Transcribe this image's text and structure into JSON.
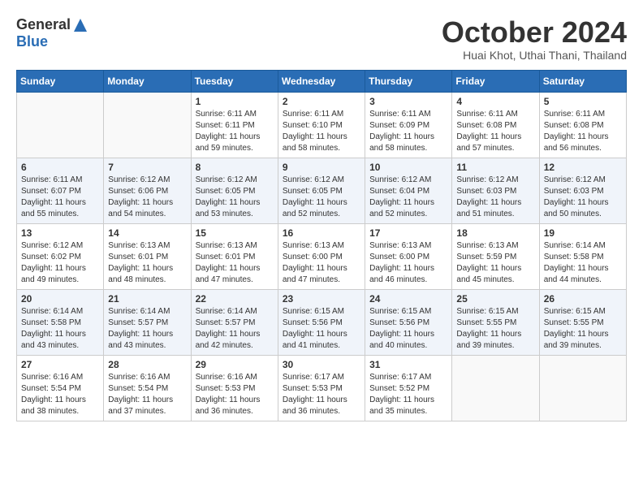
{
  "logo": {
    "general": "General",
    "blue": "Blue"
  },
  "header": {
    "month": "October 2024",
    "location": "Huai Khot, Uthai Thani, Thailand"
  },
  "columns": [
    "Sunday",
    "Monday",
    "Tuesday",
    "Wednesday",
    "Thursday",
    "Friday",
    "Saturday"
  ],
  "weeks": [
    [
      {
        "day": "",
        "info": ""
      },
      {
        "day": "",
        "info": ""
      },
      {
        "day": "1",
        "info": "Sunrise: 6:11 AM\nSunset: 6:11 PM\nDaylight: 11 hours\nand 59 minutes."
      },
      {
        "day": "2",
        "info": "Sunrise: 6:11 AM\nSunset: 6:10 PM\nDaylight: 11 hours\nand 58 minutes."
      },
      {
        "day": "3",
        "info": "Sunrise: 6:11 AM\nSunset: 6:09 PM\nDaylight: 11 hours\nand 58 minutes."
      },
      {
        "day": "4",
        "info": "Sunrise: 6:11 AM\nSunset: 6:08 PM\nDaylight: 11 hours\nand 57 minutes."
      },
      {
        "day": "5",
        "info": "Sunrise: 6:11 AM\nSunset: 6:08 PM\nDaylight: 11 hours\nand 56 minutes."
      }
    ],
    [
      {
        "day": "6",
        "info": "Sunrise: 6:11 AM\nSunset: 6:07 PM\nDaylight: 11 hours\nand 55 minutes."
      },
      {
        "day": "7",
        "info": "Sunrise: 6:12 AM\nSunset: 6:06 PM\nDaylight: 11 hours\nand 54 minutes."
      },
      {
        "day": "8",
        "info": "Sunrise: 6:12 AM\nSunset: 6:05 PM\nDaylight: 11 hours\nand 53 minutes."
      },
      {
        "day": "9",
        "info": "Sunrise: 6:12 AM\nSunset: 6:05 PM\nDaylight: 11 hours\nand 52 minutes."
      },
      {
        "day": "10",
        "info": "Sunrise: 6:12 AM\nSunset: 6:04 PM\nDaylight: 11 hours\nand 52 minutes."
      },
      {
        "day": "11",
        "info": "Sunrise: 6:12 AM\nSunset: 6:03 PM\nDaylight: 11 hours\nand 51 minutes."
      },
      {
        "day": "12",
        "info": "Sunrise: 6:12 AM\nSunset: 6:03 PM\nDaylight: 11 hours\nand 50 minutes."
      }
    ],
    [
      {
        "day": "13",
        "info": "Sunrise: 6:12 AM\nSunset: 6:02 PM\nDaylight: 11 hours\nand 49 minutes."
      },
      {
        "day": "14",
        "info": "Sunrise: 6:13 AM\nSunset: 6:01 PM\nDaylight: 11 hours\nand 48 minutes."
      },
      {
        "day": "15",
        "info": "Sunrise: 6:13 AM\nSunset: 6:01 PM\nDaylight: 11 hours\nand 47 minutes."
      },
      {
        "day": "16",
        "info": "Sunrise: 6:13 AM\nSunset: 6:00 PM\nDaylight: 11 hours\nand 47 minutes."
      },
      {
        "day": "17",
        "info": "Sunrise: 6:13 AM\nSunset: 6:00 PM\nDaylight: 11 hours\nand 46 minutes."
      },
      {
        "day": "18",
        "info": "Sunrise: 6:13 AM\nSunset: 5:59 PM\nDaylight: 11 hours\nand 45 minutes."
      },
      {
        "day": "19",
        "info": "Sunrise: 6:14 AM\nSunset: 5:58 PM\nDaylight: 11 hours\nand 44 minutes."
      }
    ],
    [
      {
        "day": "20",
        "info": "Sunrise: 6:14 AM\nSunset: 5:58 PM\nDaylight: 11 hours\nand 43 minutes."
      },
      {
        "day": "21",
        "info": "Sunrise: 6:14 AM\nSunset: 5:57 PM\nDaylight: 11 hours\nand 43 minutes."
      },
      {
        "day": "22",
        "info": "Sunrise: 6:14 AM\nSunset: 5:57 PM\nDaylight: 11 hours\nand 42 minutes."
      },
      {
        "day": "23",
        "info": "Sunrise: 6:15 AM\nSunset: 5:56 PM\nDaylight: 11 hours\nand 41 minutes."
      },
      {
        "day": "24",
        "info": "Sunrise: 6:15 AM\nSunset: 5:56 PM\nDaylight: 11 hours\nand 40 minutes."
      },
      {
        "day": "25",
        "info": "Sunrise: 6:15 AM\nSunset: 5:55 PM\nDaylight: 11 hours\nand 39 minutes."
      },
      {
        "day": "26",
        "info": "Sunrise: 6:15 AM\nSunset: 5:55 PM\nDaylight: 11 hours\nand 39 minutes."
      }
    ],
    [
      {
        "day": "27",
        "info": "Sunrise: 6:16 AM\nSunset: 5:54 PM\nDaylight: 11 hours\nand 38 minutes."
      },
      {
        "day": "28",
        "info": "Sunrise: 6:16 AM\nSunset: 5:54 PM\nDaylight: 11 hours\nand 37 minutes."
      },
      {
        "day": "29",
        "info": "Sunrise: 6:16 AM\nSunset: 5:53 PM\nDaylight: 11 hours\nand 36 minutes."
      },
      {
        "day": "30",
        "info": "Sunrise: 6:17 AM\nSunset: 5:53 PM\nDaylight: 11 hours\nand 36 minutes."
      },
      {
        "day": "31",
        "info": "Sunrise: 6:17 AM\nSunset: 5:52 PM\nDaylight: 11 hours\nand 35 minutes."
      },
      {
        "day": "",
        "info": ""
      },
      {
        "day": "",
        "info": ""
      }
    ]
  ]
}
